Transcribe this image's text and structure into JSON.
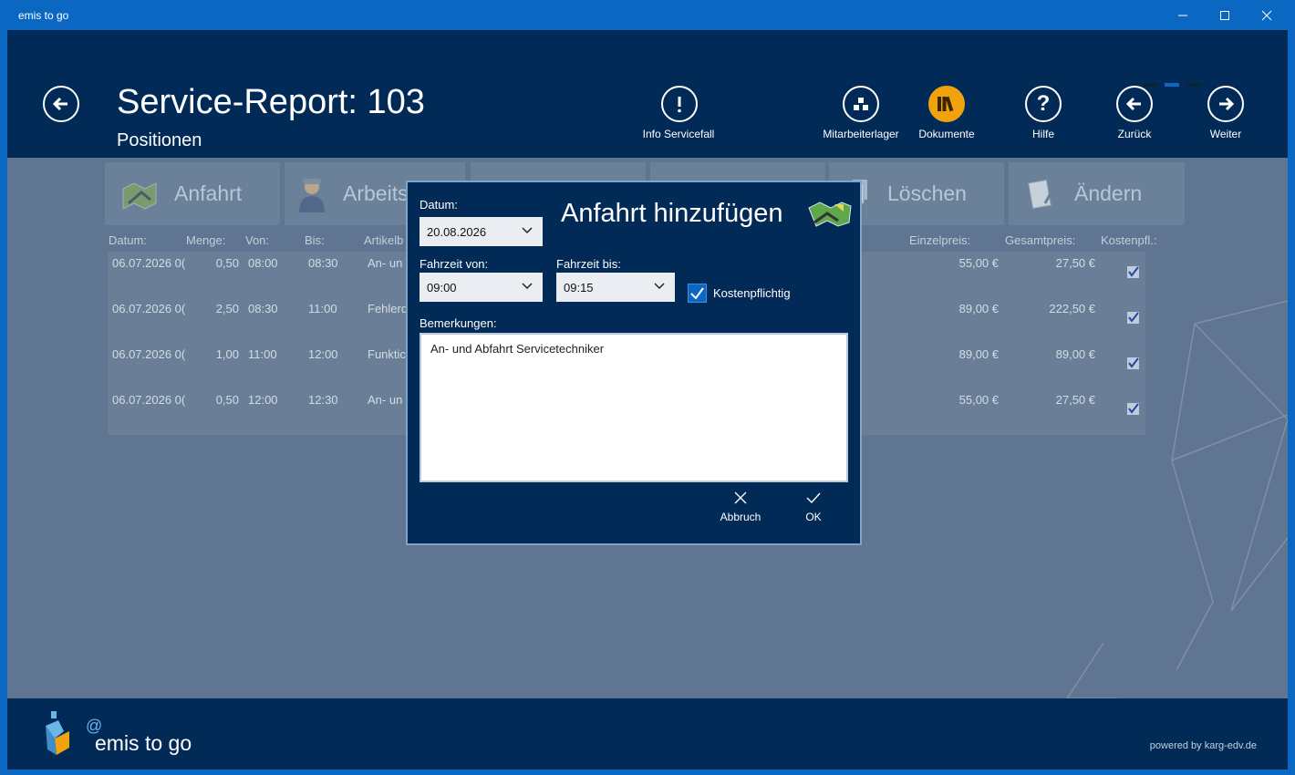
{
  "window": {
    "title": "emis to go"
  },
  "header": {
    "title": "Service-Report: 103",
    "subtitle": "Positionen",
    "actions": [
      {
        "key": "info",
        "label": "Info Servicefall"
      },
      {
        "key": "lager",
        "label": "Mitarbeiterlager"
      },
      {
        "key": "doks",
        "label": "Dokumente"
      },
      {
        "key": "hilfe",
        "label": "Hilfe"
      },
      {
        "key": "zurueck",
        "label": "Zurück"
      },
      {
        "key": "weiter",
        "label": "Weiter"
      }
    ]
  },
  "toolbar": {
    "anfahrt": "Anfahrt",
    "arbeits": "Arbeits",
    "loeschen": "Löschen",
    "aendern": "Ändern"
  },
  "table": {
    "columns": [
      "Datum:",
      "Menge:",
      "Von:",
      "Bis:",
      "Artikelb",
      "Einzelpreis:",
      "Gesamtpreis:",
      "Kostenpfl.:"
    ],
    "rows": [
      {
        "datum": "06.07.2026 0(",
        "menge": "0,50",
        "von": "08:00",
        "bis": "08:30",
        "artikel": "An- un",
        "einzel": "55,00 €",
        "gesamt": "27,50 €",
        "kosten": true
      },
      {
        "datum": "06.07.2026 0(",
        "menge": "2,50",
        "von": "08:30",
        "bis": "11:00",
        "artikel": "Fehlerd",
        "einzel": "89,00 €",
        "gesamt": "222,50 €",
        "kosten": true
      },
      {
        "datum": "06.07.2026 0(",
        "menge": "1,00",
        "von": "11:00",
        "bis": "12:00",
        "artikel": "Funktic",
        "einzel": "89,00 €",
        "gesamt": "89,00 €",
        "kosten": true
      },
      {
        "datum": "06.07.2026 0(",
        "menge": "0,50",
        "von": "12:00",
        "bis": "12:30",
        "artikel": "An- un",
        "einzel": "55,00 €",
        "gesamt": "27,50 €",
        "kosten": true
      }
    ]
  },
  "dialog": {
    "title": "Anfahrt hinzufügen",
    "datum_label": "Datum:",
    "datum_value": "20.08.2026",
    "von_label": "Fahrzeit von:",
    "von_value": "09:00",
    "bis_label": "Fahrzeit bis:",
    "bis_value": "09:15",
    "kosten_label": "Kostenpflichtig",
    "kosten_checked": true,
    "bemerkungen_label": "Bemerkungen:",
    "bemerkungen_value": "An- und Abfahrt Servicetechniker",
    "cancel_label": "Abbruch",
    "ok_label": "OK"
  },
  "footer": {
    "brand": "emis to go",
    "powered": "powered by karg-edv.de"
  },
  "colors": {
    "accent": "#0a67c2",
    "header_bg": "#012a57",
    "overlay_bg": "#5f7591",
    "dokumente_accent": "#f0a20f"
  }
}
